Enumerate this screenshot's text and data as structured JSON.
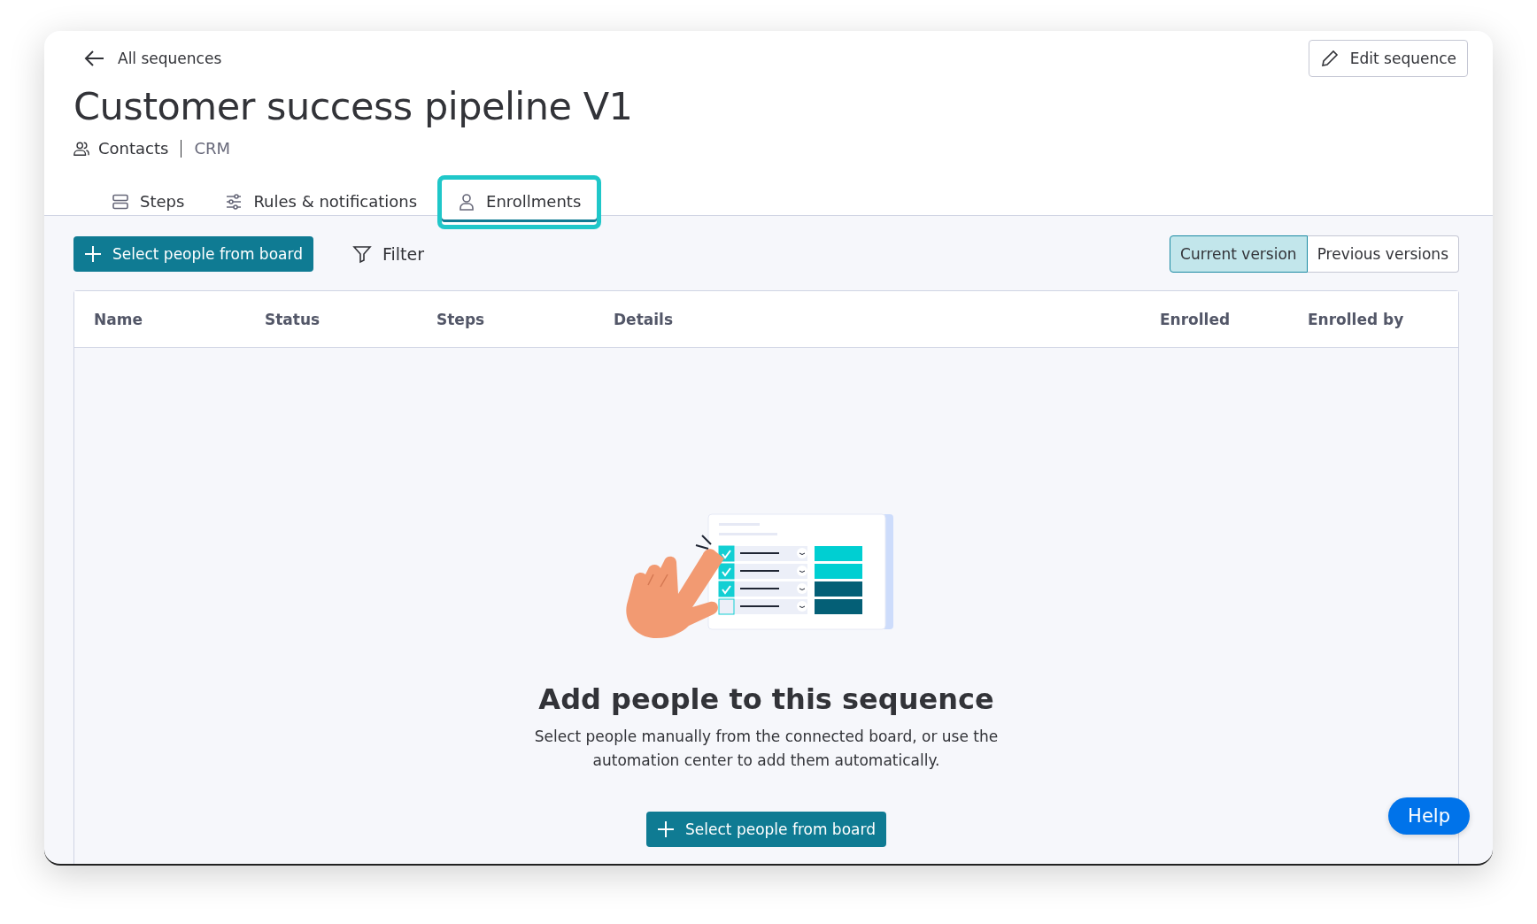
{
  "back_link": {
    "label": "All sequences"
  },
  "edit_button": {
    "label": "Edit sequence"
  },
  "title": "Customer success pipeline V1",
  "breadcrumb": {
    "board": "Contacts",
    "workspace": "CRM"
  },
  "tabs": [
    {
      "label": "Steps",
      "selected": false
    },
    {
      "label": "Rules & notifications",
      "selected": false
    },
    {
      "label": "Enrollments",
      "selected": true
    }
  ],
  "toolbar": {
    "primary_button": "Select people from board",
    "filter": "Filter"
  },
  "versions": [
    {
      "label": "Current version",
      "selected": true
    },
    {
      "label": "Previous versions",
      "selected": false
    }
  ],
  "table": {
    "columns": [
      "Name",
      "Status",
      "Steps",
      "Details",
      "Enrolled",
      "Enrolled by"
    ]
  },
  "empty_state": {
    "heading": "Add people to this sequence",
    "description": "Select people manually from the connected board, or use the automation center to add them automatically.",
    "button": "Select people from board"
  },
  "help_button": "Help"
}
